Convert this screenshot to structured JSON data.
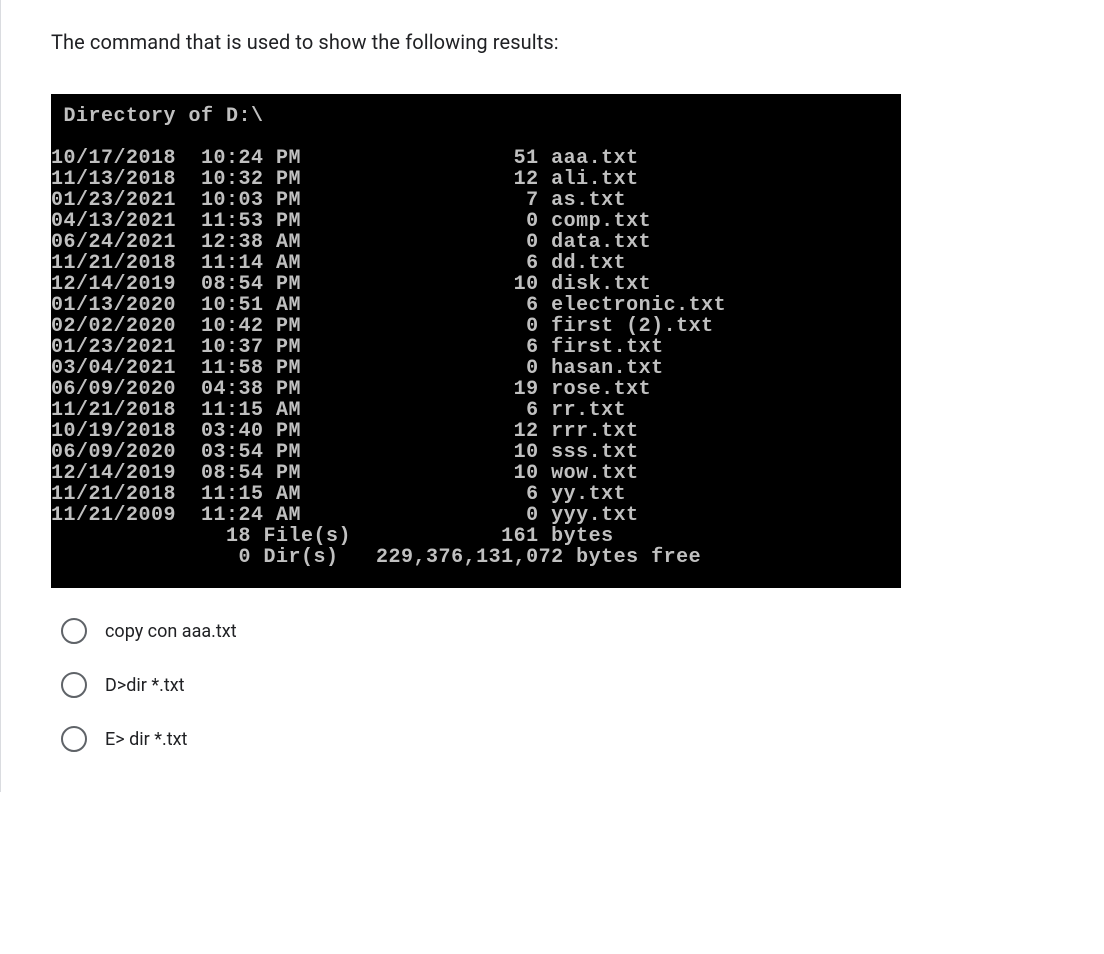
{
  "question": "The command that is used to show the following results:",
  "terminal": {
    "header": " Directory of D:\\",
    "blank": "",
    "rows": [
      {
        "date": "10/17/2018",
        "time": "10:24 PM",
        "size": "51",
        "name": "aaa.txt"
      },
      {
        "date": "11/13/2018",
        "time": "10:32 PM",
        "size": "12",
        "name": "ali.txt"
      },
      {
        "date": "01/23/2021",
        "time": "10:03 PM",
        "size": "7",
        "name": "as.txt"
      },
      {
        "date": "04/13/2021",
        "time": "11:53 PM",
        "size": "0",
        "name": "comp.txt"
      },
      {
        "date": "06/24/2021",
        "time": "12:38 AM",
        "size": "0",
        "name": "data.txt"
      },
      {
        "date": "11/21/2018",
        "time": "11:14 AM",
        "size": "6",
        "name": "dd.txt"
      },
      {
        "date": "12/14/2019",
        "time": "08:54 PM",
        "size": "10",
        "name": "disk.txt"
      },
      {
        "date": "01/13/2020",
        "time": "10:51 AM",
        "size": "6",
        "name": "electronic.txt"
      },
      {
        "date": "02/02/2020",
        "time": "10:42 PM",
        "size": "0",
        "name": "first (2).txt"
      },
      {
        "date": "01/23/2021",
        "time": "10:37 PM",
        "size": "6",
        "name": "first.txt"
      },
      {
        "date": "03/04/2021",
        "time": "11:58 PM",
        "size": "0",
        "name": "hasan.txt"
      },
      {
        "date": "06/09/2020",
        "time": "04:38 PM",
        "size": "19",
        "name": "rose.txt"
      },
      {
        "date": "11/21/2018",
        "time": "11:15 AM",
        "size": "6",
        "name": "rr.txt"
      },
      {
        "date": "10/19/2018",
        "time": "03:40 PM",
        "size": "12",
        "name": "rrr.txt"
      },
      {
        "date": "06/09/2020",
        "time": "03:54 PM",
        "size": "10",
        "name": "sss.txt"
      },
      {
        "date": "12/14/2019",
        "time": "08:54 PM",
        "size": "10",
        "name": "wow.txt"
      },
      {
        "date": "11/21/2018",
        "time": "11:15 AM",
        "size": "6",
        "name": "yy.txt"
      },
      {
        "date": "11/21/2009",
        "time": "11:24 AM",
        "size": "0",
        "name": "yyy.txt"
      }
    ],
    "summary1_count": "18",
    "summary1_label": "File(s)",
    "summary1_bytes": "161",
    "summary1_bytes_label": "bytes",
    "summary2_count": "0",
    "summary2_label": "Dir(s)",
    "summary2_bytes": "229,376,131,072",
    "summary2_bytes_label": "bytes free"
  },
  "options": [
    "copy con aaa.txt",
    "D>dir *.txt",
    "E> dir *.txt"
  ]
}
